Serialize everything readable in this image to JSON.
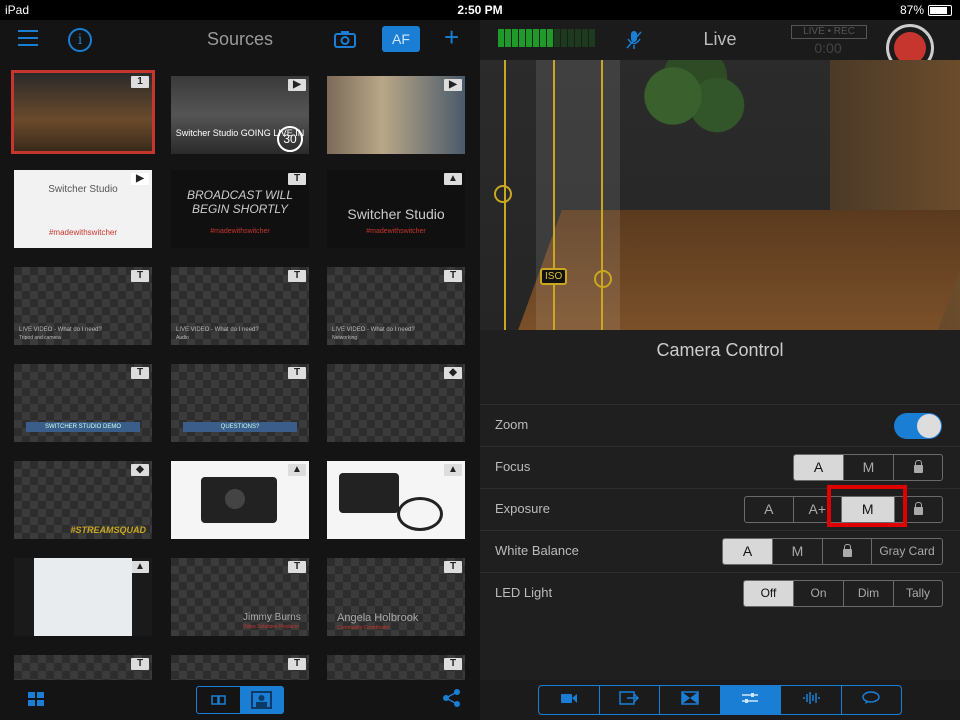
{
  "statusbar": {
    "carrier": "iPad",
    "time": "2:50 PM",
    "battery": "87%"
  },
  "sources": {
    "title": "Sources",
    "af_label": "AF",
    "tiles": [
      {
        "badge": "1",
        "text": "",
        "sub": ""
      },
      {
        "badge": "▶",
        "text": "Switcher Studio GOING LIVE IN",
        "sub": "30"
      },
      {
        "badge": "▶",
        "text": "",
        "sub": ""
      },
      {
        "badge": "▶",
        "text": "Switcher Studio",
        "sub": "#madewithswitcher"
      },
      {
        "badge": "T",
        "text": "BROADCAST WILL BEGIN SHORTLY",
        "sub": "#madewithswitcher"
      },
      {
        "badge": "▲",
        "text": "Switcher Studio",
        "sub": "#madewithswitcher"
      },
      {
        "badge": "T",
        "text": "LIVE VIDEO - What do I need?",
        "sub": "Tripod and camera"
      },
      {
        "badge": "T",
        "text": "LIVE VIDEO - What do I need?",
        "sub": "Audio"
      },
      {
        "badge": "T",
        "text": "LIVE VIDEO - What do I need?",
        "sub": "Networking"
      },
      {
        "badge": "T",
        "text": "SWITCHER STUDIO DEMO",
        "sub": ""
      },
      {
        "badge": "T",
        "text": "QUESTIONS?",
        "sub": ""
      },
      {
        "badge": "◆",
        "text": "",
        "sub": ""
      },
      {
        "badge": "◆",
        "text": "#STREAMSQUAD",
        "sub": ""
      },
      {
        "badge": "▲",
        "text": "",
        "sub": ""
      },
      {
        "badge": "▲",
        "text": "",
        "sub": ""
      },
      {
        "badge": "▲",
        "text": "",
        "sub": ""
      },
      {
        "badge": "T",
        "text": "Jimmy Burns",
        "sub": "Video Solutions Producer"
      },
      {
        "badge": "T",
        "text": "Angela Holbrook",
        "sub": "Community Coordinator"
      },
      {
        "badge": "T",
        "text": "",
        "sub": ""
      },
      {
        "badge": "T",
        "text": "",
        "sub": ""
      },
      {
        "badge": "T",
        "text": "",
        "sub": ""
      }
    ]
  },
  "live": {
    "title": "Live",
    "rec_label": "LIVE • REC",
    "timer": "0:00",
    "iso_label": "ISO"
  },
  "camera_control": {
    "title": "Camera Control",
    "rows": [
      {
        "label": "Zoom",
        "type": "toggle",
        "value": "on"
      },
      {
        "label": "Focus",
        "options": [
          "A",
          "M",
          "lock"
        ],
        "selected": "A"
      },
      {
        "label": "Exposure",
        "options": [
          "A",
          "A+",
          "M",
          "lock"
        ],
        "selected": "M"
      },
      {
        "label": "White Balance",
        "options": [
          "A",
          "M",
          "lock",
          "Gray Card"
        ],
        "selected": "A"
      },
      {
        "label": "LED Light",
        "options": [
          "Off",
          "On",
          "Dim",
          "Tally"
        ],
        "selected": "Off"
      }
    ]
  },
  "colors": {
    "accent": "#1a7fd4",
    "record": "#c7362e",
    "highlight": "#e00000",
    "overlay": "#c9a720"
  }
}
